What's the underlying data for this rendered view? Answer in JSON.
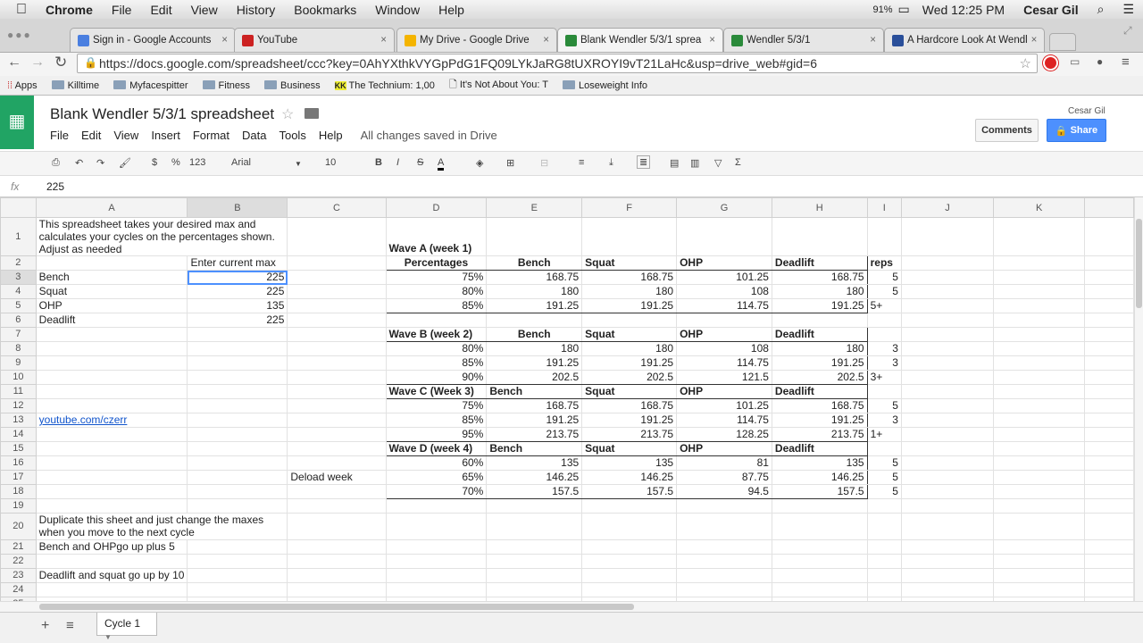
{
  "os_menu": {
    "app": "Chrome",
    "items": [
      "File",
      "Edit",
      "View",
      "History",
      "Bookmarks",
      "Window",
      "Help"
    ],
    "battery": "91%",
    "clock": "Wed 12:25 PM",
    "user": "Cesar Gil"
  },
  "tabs": [
    {
      "label": "Sign in - Google Accounts",
      "color": "#4a7fe0"
    },
    {
      "label": "YouTube",
      "color": "#cc2222"
    },
    {
      "label": "My Drive - Google Drive",
      "color": "#f4b400"
    },
    {
      "label": "Blank Wendler 5/3/1 sprea",
      "color": "#2a8a3a"
    },
    {
      "label": "Wendler 5/3/1",
      "color": "#2a8a3a"
    },
    {
      "label": "A Hardcore Look At Wendl",
      "color": "#2a4f9a"
    }
  ],
  "url": "https://docs.google.com/spreadsheet/ccc?key=0AhYXthkVYGpPdG1FQ09LYkJaRG8tUXROYI9vT21LaHc&usp=drive_web#gid=6",
  "bookmarks": [
    "Apps",
    "Killtime",
    "Myfacespitter",
    "Fitness",
    "Business",
    "The Technium: 1,00",
    "It's Not About You: T",
    "Loseweight Info"
  ],
  "doc": {
    "title": "Blank Wendler 5/3/1 spreadsheet",
    "menus": [
      "File",
      "Edit",
      "View",
      "Insert",
      "Format",
      "Data",
      "Tools",
      "Help"
    ],
    "save_status": "All changes saved in Drive",
    "user": "Cesar Gil",
    "comments": "Comments",
    "share": "Share"
  },
  "toolbar": {
    "currency": "$",
    "percent": "%",
    "format": "123",
    "font": "Arial",
    "size": "10"
  },
  "formula": {
    "label": "fx",
    "value": "225"
  },
  "columns": [
    "A",
    "B",
    "C",
    "D",
    "E",
    "F",
    "G",
    "H",
    "I",
    "J",
    "K"
  ],
  "rows": [
    [
      "This spreadsheet takes your desired max and calculates your cycles on the percentages shown. Adjust as needed",
      "",
      "",
      "Wave A (week 1)",
      "",
      "",
      "",
      "",
      "",
      "",
      ""
    ],
    [
      "",
      "Enter current max",
      "",
      "Percentages",
      "Bench",
      "Squat",
      "OHP",
      "Deadlift",
      "reps",
      "",
      ""
    ],
    [
      "Bench",
      "225",
      "",
      "75%",
      "168.75",
      "168.75",
      "101.25",
      "168.75",
      "5",
      "",
      ""
    ],
    [
      "Squat",
      "225",
      "",
      "80%",
      "180",
      "180",
      "108",
      "180",
      "5",
      "",
      ""
    ],
    [
      "OHP",
      "135",
      "",
      "85%",
      "191.25",
      "191.25",
      "114.75",
      "191.25",
      "5+",
      "",
      ""
    ],
    [
      "Deadlift",
      "225",
      "",
      "",
      "",
      "",
      "",
      "",
      "",
      "",
      ""
    ],
    [
      "",
      "",
      "",
      "Wave B (week 2)",
      "Bench",
      "Squat",
      "OHP",
      "Deadlift",
      "",
      "",
      ""
    ],
    [
      "",
      "",
      "",
      "80%",
      "180",
      "180",
      "108",
      "180",
      "3",
      "",
      ""
    ],
    [
      "",
      "",
      "",
      "85%",
      "191.25",
      "191.25",
      "114.75",
      "191.25",
      "3",
      "",
      ""
    ],
    [
      "",
      "",
      "",
      "90%",
      "202.5",
      "202.5",
      "121.5",
      "202.5",
      "3+",
      "",
      ""
    ],
    [
      "",
      "",
      "",
      "Wave C (Week 3)",
      "Bench",
      "Squat",
      "OHP",
      "Deadlift",
      "",
      "",
      ""
    ],
    [
      "",
      "",
      "",
      "75%",
      "168.75",
      "168.75",
      "101.25",
      "168.75",
      "5",
      "",
      ""
    ],
    [
      "youtube.com/czerr",
      "",
      "",
      "85%",
      "191.25",
      "191.25",
      "114.75",
      "191.25",
      "3",
      "",
      ""
    ],
    [
      "",
      "",
      "",
      "95%",
      "213.75",
      "213.75",
      "128.25",
      "213.75",
      "1+",
      "",
      ""
    ],
    [
      "",
      "",
      "",
      "Wave D (week 4)",
      "Bench",
      "Squat",
      "OHP",
      "Deadlift",
      "",
      "",
      ""
    ],
    [
      "",
      "",
      "",
      "60%",
      "135",
      "135",
      "81",
      "135",
      "5",
      "",
      ""
    ],
    [
      "",
      "",
      "Deload week",
      "65%",
      "146.25",
      "146.25",
      "87.75",
      "146.25",
      "5",
      "",
      ""
    ],
    [
      "",
      "",
      "",
      "70%",
      "157.5",
      "157.5",
      "94.5",
      "157.5",
      "5",
      "",
      ""
    ],
    [
      "",
      "",
      "",
      "",
      "",
      "",
      "",
      "",
      "",
      "",
      ""
    ],
    [
      "Duplicate this sheet and just change the maxes when you move to the next cycle",
      "",
      "",
      "",
      "",
      "",
      "",
      "",
      "",
      "",
      ""
    ],
    [
      "Bench and OHPgo up plus 5",
      "",
      "",
      "",
      "",
      "",
      "",
      "",
      "",
      "",
      ""
    ],
    [
      "",
      "",
      "",
      "",
      "",
      "",
      "",
      "",
      "",
      "",
      ""
    ],
    [
      "Deadlift and squat go up by 10",
      "",
      "",
      "",
      "",
      "",
      "",
      "",
      "",
      "",
      ""
    ],
    [
      "",
      "",
      "",
      "",
      "",
      "",
      "",
      "",
      "",
      "",
      ""
    ],
    [
      "",
      "",
      "",
      "",
      "",
      "",
      "",
      "",
      "",
      "",
      ""
    ]
  ],
  "sheet_tab": "Cycle 1"
}
